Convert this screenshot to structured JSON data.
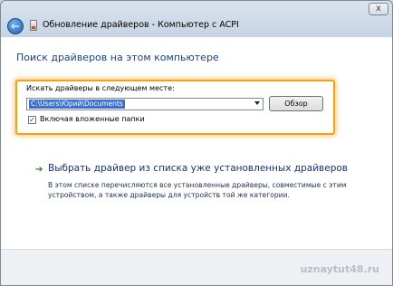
{
  "window": {
    "title": "Обновление драйверов - Компьютер с ACPI",
    "back_icon": "back-arrow-icon",
    "close_label": "x"
  },
  "main": {
    "heading": "Поиск драйверов на этом компьютере",
    "search_label": "Искать драйверы в следующем месте:",
    "path_value": "C:\\Users\\Юрий\\Documents",
    "browse_label": "Обзор",
    "include_subfolders": {
      "checked": true,
      "label": "Включая вложенные папки"
    },
    "pick_link": "Выбрать драйвер из списка уже установленных драйверов",
    "pick_description": "В этом списке перечисляются все установленные драйверы, совместимые с этим устройством, а также драйверы для устройств той же категории."
  },
  "watermark": "uznaytut48.ru",
  "colors": {
    "heading": "#1a3f8f",
    "highlight": "#f2a11a",
    "selection": "#3b6fd0"
  }
}
